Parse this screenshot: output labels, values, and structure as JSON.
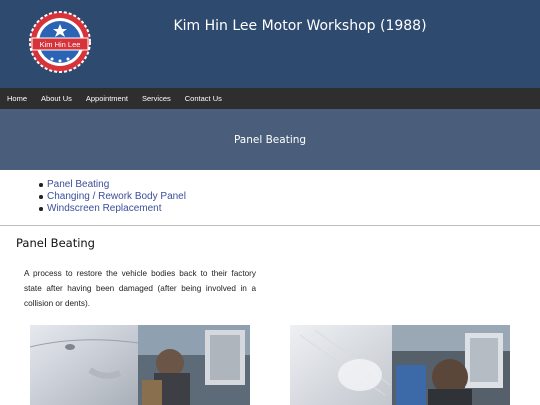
{
  "header": {
    "logo_text": "Kim Hin Lee",
    "site_title": "Kim Hin Lee Motor Workshop (1988)"
  },
  "nav": {
    "items": [
      "Home",
      "About Us",
      "Appointment",
      "Services",
      "Contact Us"
    ]
  },
  "page": {
    "banner_title": "Panel Beating"
  },
  "services": {
    "items": [
      "Panel Beating",
      "Changing / Rework Body Panel",
      "Windscreen Replacement"
    ]
  },
  "section": {
    "title": "Panel Beating",
    "description": "A process to restore the vehicle bodies back to their factory state after having been damaged (after being involved in a collision or dents)."
  },
  "colors": {
    "header_bg": "#2f4a6f",
    "nav_bg": "#2e2e2e",
    "banner_bg": "#4a5d7a",
    "link": "#3b4f9a",
    "logo_red": "#d6333b",
    "logo_blue": "#2c64b5"
  }
}
